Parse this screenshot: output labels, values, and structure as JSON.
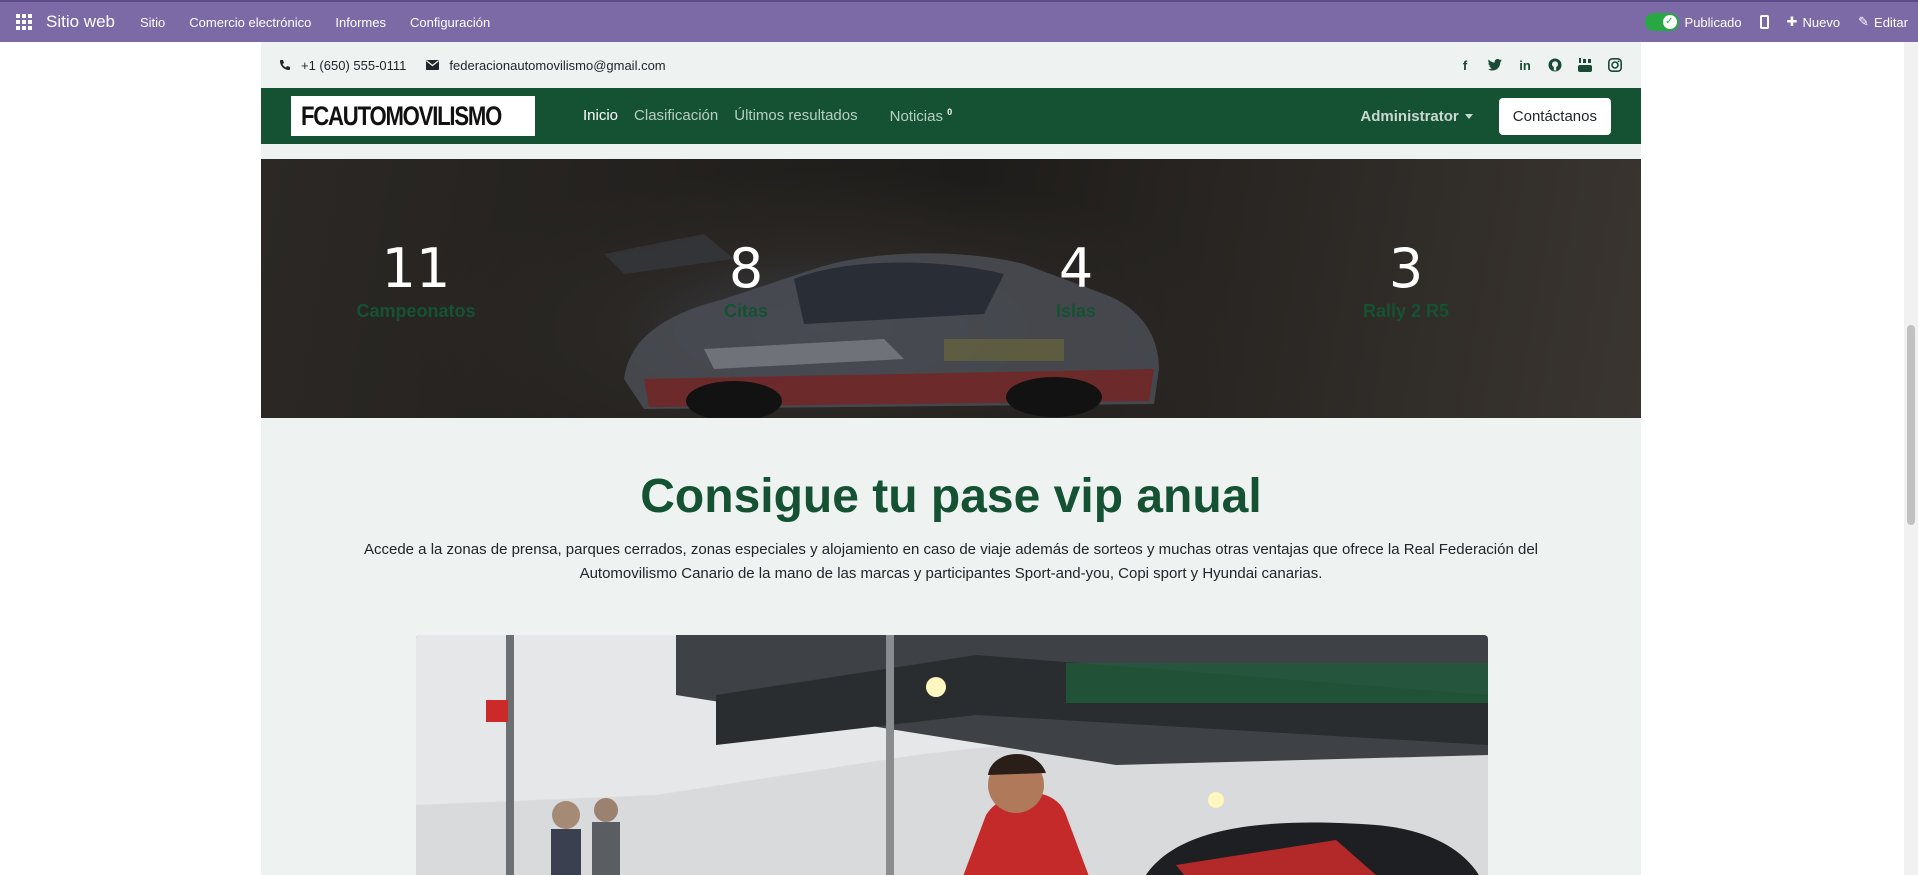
{
  "odoo_bar": {
    "app_name": "Sitio web",
    "menu": [
      "Sitio",
      "Comercio electrónico",
      "Informes",
      "Configuración"
    ],
    "published_label": "Publicado",
    "new_label": "Nuevo",
    "edit_label": "Editar"
  },
  "contact": {
    "phone": "+1 (650) 555-0111",
    "email": "federacionautomovilismo@gmail.com"
  },
  "social_icons": [
    "facebook-icon",
    "twitter-icon",
    "linkedin-icon",
    "github-icon",
    "youtube-icon",
    "instagram-icon"
  ],
  "navbar": {
    "logo_text": "FCAUTOMOVILISMO",
    "items": [
      "Inicio",
      "Clasificación",
      "Últimos resultados"
    ],
    "news_label": "Noticias",
    "news_count": "0",
    "admin_label": "Administrator",
    "contact_button": "Contáctanos"
  },
  "stats": [
    {
      "value": "11",
      "label": "Campeonatos"
    },
    {
      "value": "8",
      "label": "Citas"
    },
    {
      "value": "4",
      "label": "Islas"
    },
    {
      "value": "3",
      "label": "Rally 2 R5"
    }
  ],
  "vip": {
    "title": "Consigue tu pase vip anual",
    "text": "Accede a la zonas de prensa, parques cerrados, zonas especiales y alojamiento en caso de viaje además de sorteos y muchas otras ventajas que ofrece la Real Federación del Automovilismo Canario de la mano de las marcas y participantes Sport-and-you, Copi sport y Hyundai canarias."
  },
  "colors": {
    "odoo_purple": "#7c6aa6",
    "brand_green": "#145233",
    "section_bg": "#eef2f0"
  }
}
